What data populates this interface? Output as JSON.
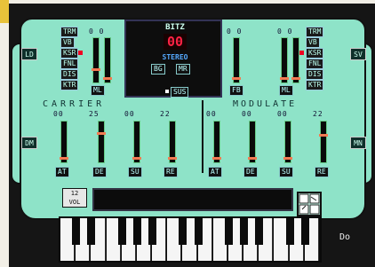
{
  "center": {
    "title": "BITZ",
    "led": "00",
    "mode": "STEREO",
    "b1": "BG",
    "b2": "MR",
    "sus": "SUS"
  },
  "left_stack": [
    "TRM",
    "VB",
    "KSR",
    "FNL",
    "DIS",
    "KTR"
  ],
  "right_stack": [
    "TRM",
    "VB",
    "KSR",
    "FNL",
    "DIS",
    "KTR"
  ],
  "left_ml": "ML",
  "right_ml": "ML",
  "tl": "TL",
  "fb": "FB",
  "side": {
    "ld": "LD",
    "dm": "DM",
    "sv": "SV",
    "mn": "MN"
  },
  "sections": {
    "carrier": "CARRIER",
    "modulate": "MODULATE"
  },
  "carrier_ops": [
    {
      "label": "AT",
      "value": "00"
    },
    {
      "label": "DE",
      "value": "25"
    },
    {
      "label": "SU",
      "value": "00"
    },
    {
      "label": "RE",
      "value": "22"
    }
  ],
  "modulate_ops": [
    {
      "label": "AT",
      "value": "00"
    },
    {
      "label": "DE",
      "value": "00"
    },
    {
      "label": "SU",
      "value": "00"
    },
    {
      "label": "RE",
      "value": "22"
    }
  ],
  "vol": {
    "value": "12",
    "label": "VOL"
  },
  "ticker": "Do"
}
